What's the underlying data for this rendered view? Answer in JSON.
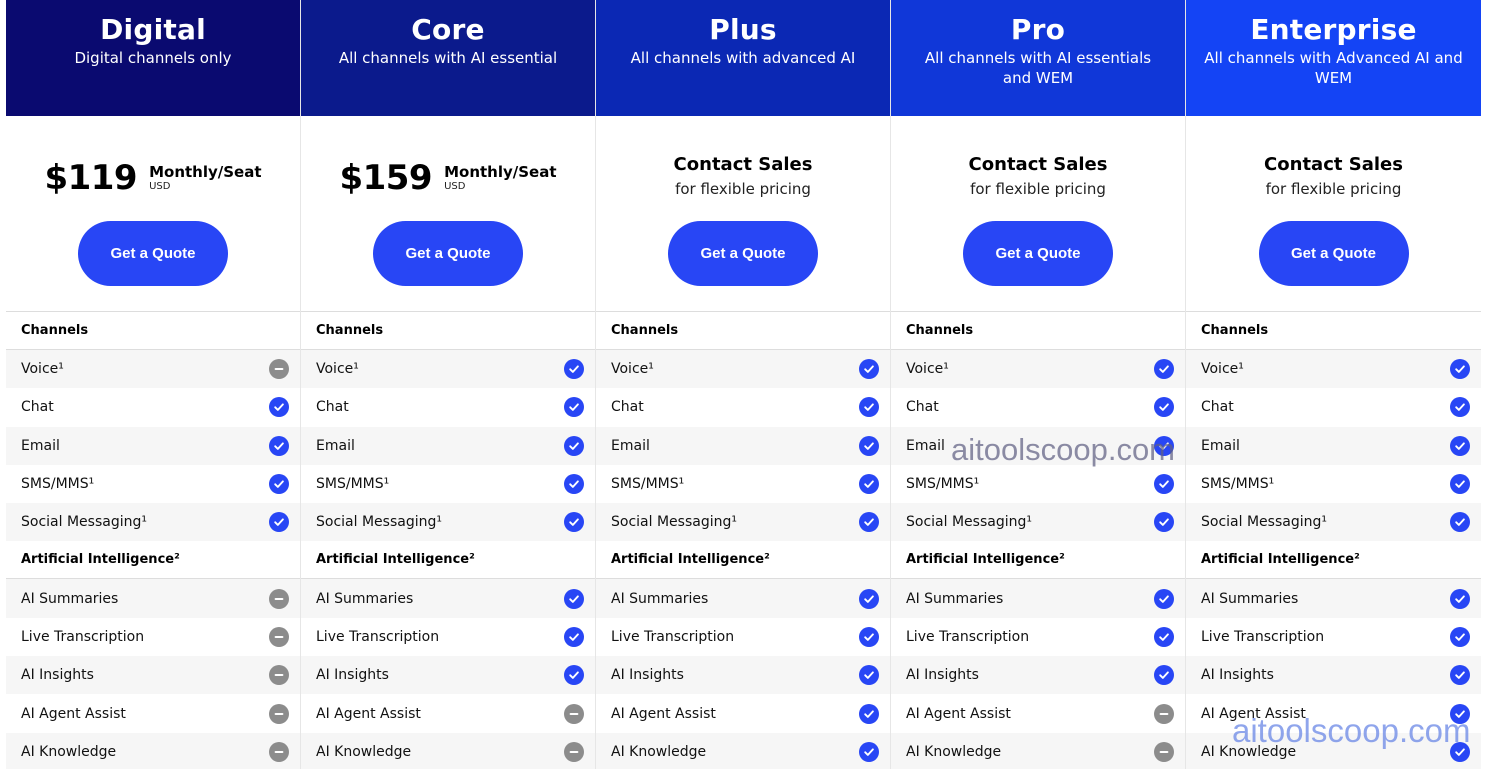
{
  "plans": [
    {
      "id": "digital",
      "name": "Digital",
      "subtitle": "Digital channels only",
      "header_color": "#0a0a70",
      "price": "$119",
      "period": "Monthly/Seat",
      "currency": "USD",
      "contact_title": "",
      "contact_sub": "",
      "cta": "Get a Quote",
      "channels_title": "Channels",
      "channels": [
        {
          "label": "Voice¹",
          "included": false
        },
        {
          "label": "Chat",
          "included": true
        },
        {
          "label": "Email",
          "included": true
        },
        {
          "label": "SMS/MMS¹",
          "included": true
        },
        {
          "label": "Social Messaging¹",
          "included": true
        }
      ],
      "ai_title": "Artificial Intelligence²",
      "ai": [
        {
          "label": "AI Summaries",
          "included": false
        },
        {
          "label": "Live Transcription",
          "included": false
        },
        {
          "label": "AI Insights",
          "included": false
        },
        {
          "label": "AI Agent Assist",
          "included": false
        },
        {
          "label": "AI Knowledge",
          "included": false
        }
      ]
    },
    {
      "id": "core",
      "name": "Core",
      "subtitle": "All channels with AI essential",
      "header_color": "#0b1a8c",
      "price": "$159",
      "period": "Monthly/Seat",
      "currency": "USD",
      "contact_title": "",
      "contact_sub": "",
      "cta": "Get a Quote",
      "channels_title": "Channels",
      "channels": [
        {
          "label": "Voice¹",
          "included": true
        },
        {
          "label": "Chat",
          "included": true
        },
        {
          "label": "Email",
          "included": true
        },
        {
          "label": "SMS/MMS¹",
          "included": true
        },
        {
          "label": "Social Messaging¹",
          "included": true
        }
      ],
      "ai_title": "Artificial Intelligence²",
      "ai": [
        {
          "label": "AI Summaries",
          "included": true
        },
        {
          "label": "Live Transcription",
          "included": true
        },
        {
          "label": "AI Insights",
          "included": true
        },
        {
          "label": "AI Agent Assist",
          "included": false
        },
        {
          "label": "AI Knowledge",
          "included": false
        }
      ]
    },
    {
      "id": "plus",
      "name": "Plus",
      "subtitle": "All channels with advanced AI",
      "header_color": "#0b28b4",
      "price": "",
      "period": "",
      "currency": "",
      "contact_title": "Contact Sales",
      "contact_sub": "for flexible pricing",
      "cta": "Get a Quote",
      "channels_title": "Channels",
      "channels": [
        {
          "label": "Voice¹",
          "included": true
        },
        {
          "label": "Chat",
          "included": true
        },
        {
          "label": "Email",
          "included": true
        },
        {
          "label": "SMS/MMS¹",
          "included": true
        },
        {
          "label": "Social Messaging¹",
          "included": true
        }
      ],
      "ai_title": "Artificial Intelligence²",
      "ai": [
        {
          "label": "AI Summaries",
          "included": true
        },
        {
          "label": "Live Transcription",
          "included": true
        },
        {
          "label": "AI Insights",
          "included": true
        },
        {
          "label": "AI Agent Assist",
          "included": true
        },
        {
          "label": "AI Knowledge",
          "included": true
        }
      ]
    },
    {
      "id": "pro",
      "name": "Pro",
      "subtitle": "All channels with AI essentials and WEM",
      "header_color": "#1037d8",
      "price": "",
      "period": "",
      "currency": "",
      "contact_title": "Contact Sales",
      "contact_sub": "for flexible pricing",
      "cta": "Get a Quote",
      "channels_title": "Channels",
      "channels": [
        {
          "label": "Voice¹",
          "included": true
        },
        {
          "label": "Chat",
          "included": true
        },
        {
          "label": "Email",
          "included": true
        },
        {
          "label": "SMS/MMS¹",
          "included": true
        },
        {
          "label": "Social Messaging¹",
          "included": true
        }
      ],
      "ai_title": "Artificial Intelligence²",
      "ai": [
        {
          "label": "AI Summaries",
          "included": true
        },
        {
          "label": "Live Transcription",
          "included": true
        },
        {
          "label": "AI Insights",
          "included": true
        },
        {
          "label": "AI Agent Assist",
          "included": false
        },
        {
          "label": "AI Knowledge",
          "included": false
        }
      ]
    },
    {
      "id": "enterprise",
      "name": "Enterprise",
      "subtitle": "All channels with Advanced AI and WEM",
      "header_color": "#1444f5",
      "price": "",
      "period": "",
      "currency": "",
      "contact_title": "Contact Sales",
      "contact_sub": "for flexible pricing",
      "cta": "Get a Quote",
      "channels_title": "Channels",
      "channels": [
        {
          "label": "Voice¹",
          "included": true
        },
        {
          "label": "Chat",
          "included": true
        },
        {
          "label": "Email",
          "included": true
        },
        {
          "label": "SMS/MMS¹",
          "included": true
        },
        {
          "label": "Social Messaging¹",
          "included": true
        }
      ],
      "ai_title": "Artificial Intelligence²",
      "ai": [
        {
          "label": "AI Summaries",
          "included": true
        },
        {
          "label": "Live Transcription",
          "included": true
        },
        {
          "label": "AI Insights",
          "included": true
        },
        {
          "label": "AI Agent Assist",
          "included": true
        },
        {
          "label": "AI Knowledge",
          "included": true
        }
      ]
    }
  ],
  "icons": {
    "included": "check-icon",
    "excluded": "dash-icon"
  },
  "colors": {
    "button": "#2846f5",
    "check": "#2846f5",
    "dash": "#8c8c8c"
  },
  "watermarks": [
    "aitoolscoop.com",
    "aitoolscoop.com"
  ]
}
